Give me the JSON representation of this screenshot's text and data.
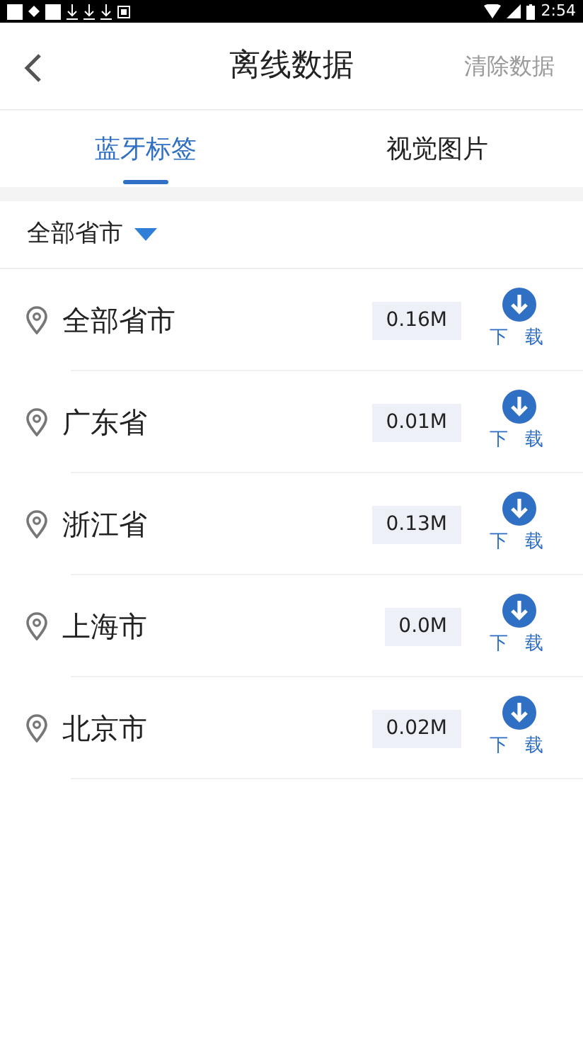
{
  "status_bar": {
    "time": "2:54"
  },
  "header": {
    "title": "离线数据",
    "action": "清除数据"
  },
  "tabs": [
    {
      "label": "蓝牙标签",
      "selected": true
    },
    {
      "label": "视觉图片",
      "selected": false
    }
  ],
  "filter": {
    "label": "全部省市"
  },
  "rows": [
    {
      "name": "全部省市",
      "size": "0.16M",
      "action": "下 载"
    },
    {
      "name": "广东省",
      "size": "0.01M",
      "action": "下 载"
    },
    {
      "name": "浙江省",
      "size": "0.13M",
      "action": "下 载"
    },
    {
      "name": "上海市",
      "size": "0.0M",
      "action": "下 载"
    },
    {
      "name": "北京市",
      "size": "0.02M",
      "action": "下 载"
    }
  ]
}
